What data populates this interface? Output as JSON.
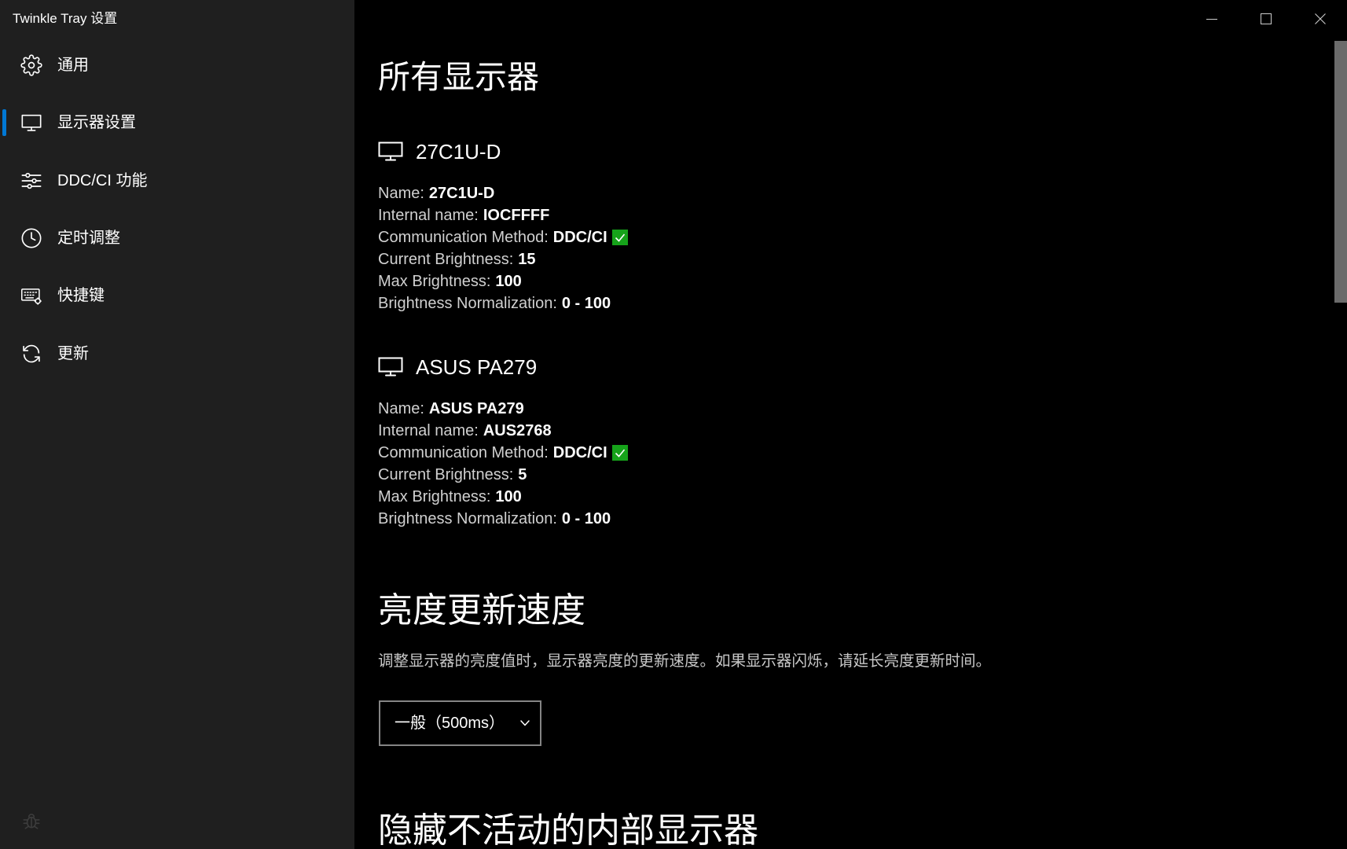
{
  "window": {
    "title": "Twinkle Tray 设置",
    "controls": {
      "minimize_icon": "minimize-icon",
      "maximize_icon": "maximize-icon",
      "close_icon": "close-icon"
    }
  },
  "theme": {
    "sidebar_bg": "#1f1f1f",
    "main_bg": "#000000",
    "accent": "#0078d4",
    "success": "#16a31a",
    "text": "#ffffff",
    "muted_text": "#c8c8c8"
  },
  "sidebar": {
    "items": [
      {
        "label": "通用",
        "icon": "gear-icon",
        "active": false
      },
      {
        "label": "显示器设置",
        "icon": "monitor-icon",
        "active": true
      },
      {
        "label": "DDC/CI 功能",
        "icon": "sliders-icon",
        "active": false
      },
      {
        "label": "定时调整",
        "icon": "clock-icon",
        "active": false
      },
      {
        "label": "快捷键",
        "icon": "keyboard-icon",
        "active": false
      },
      {
        "label": "更新",
        "icon": "refresh-icon",
        "active": false
      }
    ],
    "footer_icon": "bug-icon"
  },
  "main": {
    "all_displays": {
      "heading": "所有显示器",
      "monitors": [
        {
          "icon": "monitor-icon",
          "title": "27C1U-D",
          "fields": [
            {
              "label": "Name:",
              "value": "27C1U-D"
            },
            {
              "label": "Internal name:",
              "value": "IOCFFFF"
            },
            {
              "label": "Communication Method:",
              "value": "DDC/CI",
              "status_icon": "check-icon"
            },
            {
              "label": "Current Brightness:",
              "value": "15"
            },
            {
              "label": "Max Brightness:",
              "value": "100"
            },
            {
              "label": "Brightness Normalization:",
              "value": "0 - 100"
            }
          ]
        },
        {
          "icon": "monitor-icon",
          "title": "ASUS PA279",
          "fields": [
            {
              "label": "Name:",
              "value": "ASUS PA279"
            },
            {
              "label": "Internal name:",
              "value": "AUS2768"
            },
            {
              "label": "Communication Method:",
              "value": "DDC/CI",
              "status_icon": "check-icon"
            },
            {
              "label": "Current Brightness:",
              "value": "5"
            },
            {
              "label": "Max Brightness:",
              "value": "100"
            },
            {
              "label": "Brightness Normalization:",
              "value": "0 - 100"
            }
          ]
        }
      ]
    },
    "update_speed": {
      "heading": "亮度更新速度",
      "description": "调整显示器的亮度值时，显示器亮度的更新速度。如果显示器闪烁，请延长亮度更新时间。",
      "select": {
        "value": "一般（500ms）",
        "icon": "chevron-down-icon"
      }
    },
    "hide_internal": {
      "heading": "隐藏不活动的内部显示器"
    }
  }
}
